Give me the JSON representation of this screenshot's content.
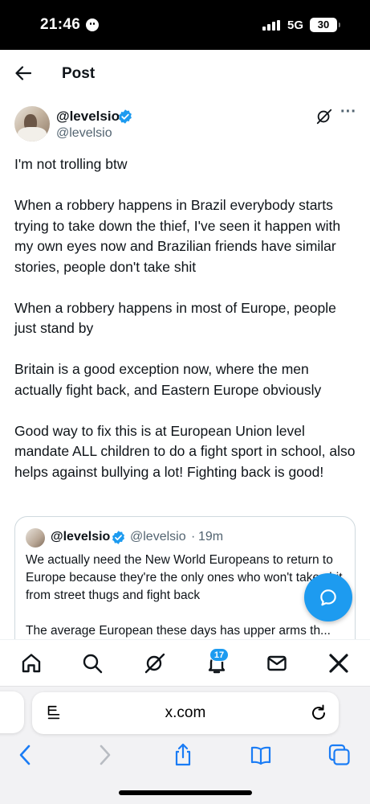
{
  "status_bar": {
    "time": "21:46",
    "network": "5G",
    "battery": "30"
  },
  "header": {
    "title": "Post",
    "back_icon": "arrow-left-icon"
  },
  "post": {
    "author_handle_display": "@levelsio",
    "author_handle": "@levelsio",
    "paragraphs": [
      "I'm not trolling btw",
      "When a robbery happens in Brazil everybody starts trying to take down the thief, I've seen it happen with my own eyes now and Brazilian friends have similar stories, people don't take shit",
      "When a robbery happens in most of Europe, people just stand by",
      "Britain is a good exception now, where the men actually fight back, and Eastern Europe obviously",
      "Good way to fix this is at European Union level mandate ALL children to do a fight sport in school, also helps against bullying a lot! Fighting back is good!"
    ],
    "more_label": "···"
  },
  "quote": {
    "name": "@levelsio",
    "handle": "@levelsio",
    "dot": "·",
    "time": "19m",
    "text1": "We actually need the New World Europeans to return to Europe because they're the only ones who won't take shit from street thugs and fight back",
    "text2": "The average European these days has upper arms th..."
  },
  "tabbar": {
    "items": [
      "home-icon",
      "search-icon",
      "grok-icon",
      "notifications-icon",
      "messages-icon",
      "x-logo-icon"
    ],
    "notification_count": "17"
  },
  "safari": {
    "address": "x.com"
  },
  "colors": {
    "accent": "#1d9bf0",
    "text": "#0f1419",
    "secondary": "#536471"
  }
}
